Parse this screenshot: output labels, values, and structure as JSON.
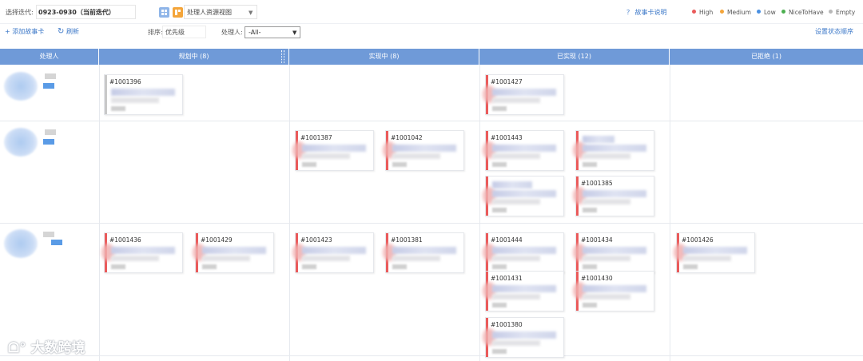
{
  "toolbar": {
    "sprint_label": "选择迭代:",
    "sprint_value": "0923-0930（当前迭代）",
    "view_label": "处理人资源视图",
    "help_link": "？ 故事卡说明",
    "legend": [
      {
        "label": "High",
        "color": "#ea5b5b"
      },
      {
        "label": "Medium",
        "color": "#f4a53a"
      },
      {
        "label": "Low",
        "color": "#4a90e2"
      },
      {
        "label": "NiceToHave",
        "color": "#4caf50"
      },
      {
        "label": "Empty",
        "color": "#b8b8b8"
      }
    ],
    "add_story": "+ 添加故事卡",
    "refresh": "刷新",
    "sort_label": "排序:",
    "sort_value": "优先级",
    "assignee_label": "处理人:",
    "assignee_value": "-All-",
    "status_order": "设置状态顺序"
  },
  "board": {
    "assignee_header": "处理人",
    "columns": [
      {
        "label": "规划中 (8)"
      },
      {
        "label": "实现中 (8)"
      },
      {
        "label": "已实现 (12)"
      },
      {
        "label": "已拒绝 (1)"
      }
    ]
  },
  "cards": {
    "c1001396": "#1001396",
    "c1001427": "#1001427",
    "c1001387": "#1001387",
    "c1001042": "#1001042",
    "c1001443": "#1001443",
    "c1001385": "#1001385",
    "c1001436": "#1001436",
    "c1001429": "#1001429",
    "c1001423": "#1001423",
    "c1001381": "#1001381",
    "c1001444": "#1001444",
    "c1001434": "#1001434",
    "c1001426": "#1001426",
    "c1001431": "#1001431",
    "c1001430": "#1001430",
    "c1001380": "#1001380"
  },
  "watermark": "大数跨境"
}
